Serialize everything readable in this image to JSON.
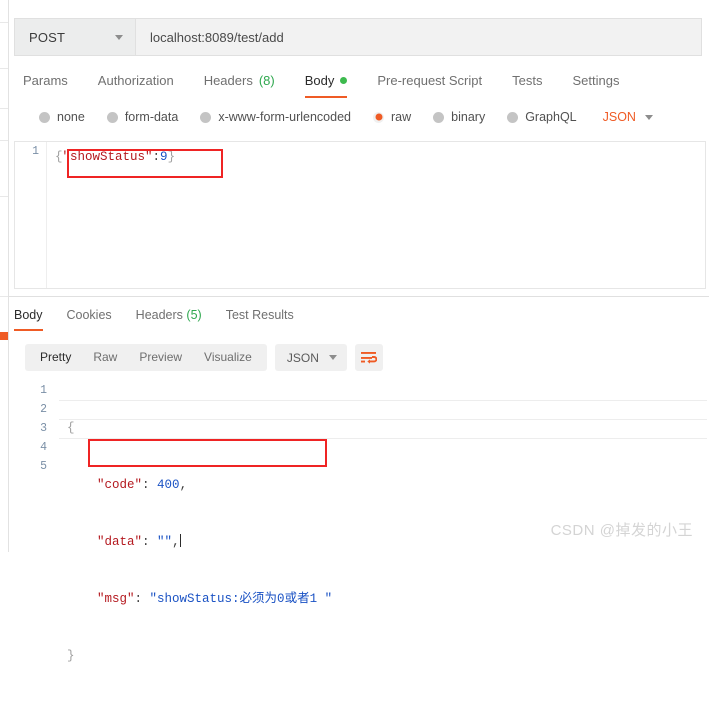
{
  "request": {
    "method": "POST",
    "url": "localhost:8089/test/add",
    "tabs": [
      {
        "label": "Params",
        "active": false
      },
      {
        "label": "Authorization",
        "active": false
      },
      {
        "label": "Headers",
        "count": "(8)",
        "active": false
      },
      {
        "label": "Body",
        "active": true,
        "dot": "green-status-dot"
      },
      {
        "label": "Pre-request Script",
        "active": false
      },
      {
        "label": "Tests",
        "active": false
      },
      {
        "label": "Settings",
        "active": false
      }
    ],
    "body_types": [
      {
        "label": "none",
        "selected": false
      },
      {
        "label": "form-data",
        "selected": false
      },
      {
        "label": "x-www-form-urlencoded",
        "selected": false
      },
      {
        "label": "raw",
        "selected": true
      },
      {
        "label": "binary",
        "selected": false
      },
      {
        "label": "GraphQL",
        "selected": false
      }
    ],
    "format": "JSON",
    "editor": {
      "line_numbers": [
        "1"
      ],
      "code": {
        "open_brace": "{",
        "key": "\"showStatus\"",
        "colon": ":",
        "value": "9",
        "close_brace": "}"
      },
      "full_text": "{\"showStatus\":9}"
    }
  },
  "response": {
    "tabs": [
      {
        "label": "Body",
        "active": true
      },
      {
        "label": "Cookies",
        "active": false
      },
      {
        "label": "Headers",
        "count": "(5)",
        "active": false
      },
      {
        "label": "Test Results",
        "active": false
      }
    ],
    "view_modes": [
      {
        "label": "Pretty",
        "active": true
      },
      {
        "label": "Raw",
        "active": false
      },
      {
        "label": "Preview",
        "active": false
      },
      {
        "label": "Visualize",
        "active": false
      }
    ],
    "format": "JSON",
    "wrap_icon": "word-wrap-icon",
    "editor": {
      "line_numbers": [
        "1",
        "2",
        "3",
        "4",
        "5"
      ],
      "lines": [
        {
          "text": "{"
        },
        {
          "key": "\"code\"",
          "sep": ": ",
          "value": "400",
          "trail": ","
        },
        {
          "key": "\"data\"",
          "sep": ": ",
          "value": "\"\"",
          "trail": ","
        },
        {
          "key": "\"msg\"",
          "sep": ": ",
          "value": "\"showStatus:必须为0或者1 \"",
          "trail": ""
        },
        {
          "text": "}"
        }
      ]
    }
  },
  "annotations": {
    "request_highlight_color": "#ef2424",
    "response_highlight_color": "#ef2424"
  },
  "theme": {
    "accent": "#ef5b25",
    "success": "#2fa84f",
    "status_dot": "#3dba4e"
  },
  "watermark": "CSDN @掉发的小王"
}
